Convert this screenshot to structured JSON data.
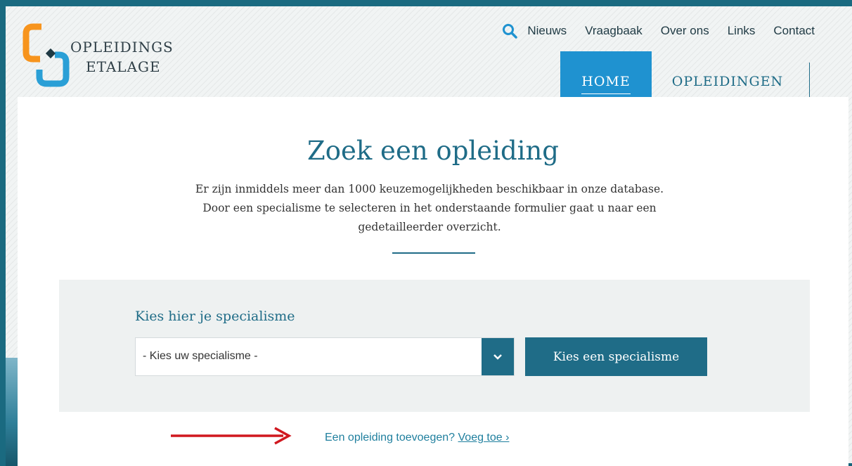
{
  "header": {
    "logo": {
      "line1": "OPLEIDINGS",
      "line2": "ETALAGE"
    },
    "topnav": {
      "items": [
        "Nieuws",
        "Vraagbaak",
        "Over ons",
        "Links",
        "Contact"
      ]
    },
    "mainnav": {
      "home": "HOME",
      "opleidingen": "OPLEIDINGEN"
    }
  },
  "main": {
    "title": "Zoek een opleiding",
    "intro": "Er zijn inmiddels meer dan 1000 keuzemogelijkheden beschikbaar in onze database. Door een specialisme te selecteren in het onderstaande formulier gaat u naar een gedetailleerder overzicht."
  },
  "form": {
    "label": "Kies hier je specialisme",
    "select_value": "- Kies uw specialisme -",
    "button": "Kies een specialisme"
  },
  "add": {
    "text": "Een opleiding toevoegen?",
    "link": "Voeg toe ›"
  },
  "colors": {
    "accent": "#1f6c87",
    "nav_active": "#1f92d0",
    "logo_orange": "#f7941d",
    "logo_blue": "#2a9fd6",
    "arrow": "#d0181f"
  }
}
